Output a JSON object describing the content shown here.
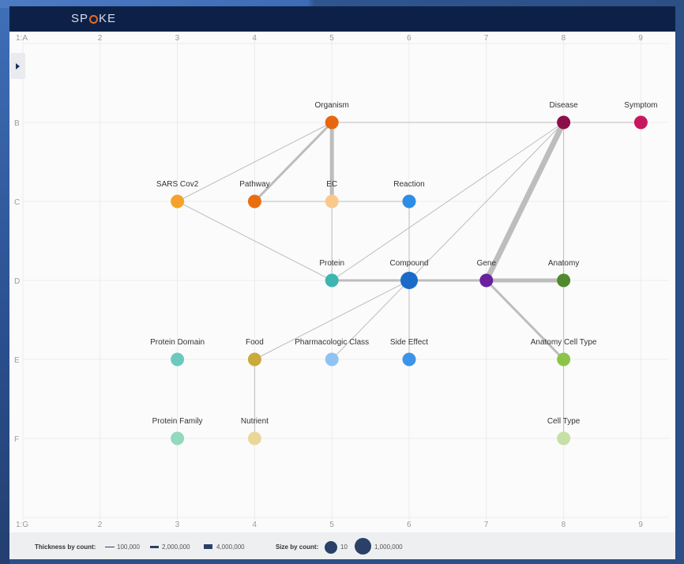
{
  "app": {
    "logo_text": "SPOKE"
  },
  "grid": {
    "columns": [
      "1:A",
      "2",
      "3",
      "4",
      "5",
      "6",
      "7",
      "8",
      "9"
    ],
    "bottom_columns": [
      "1:G",
      "2",
      "3",
      "4",
      "5",
      "6",
      "7",
      "8",
      "9"
    ],
    "rows": [
      "B",
      "C",
      "D",
      "E",
      "F"
    ]
  },
  "nodes": [
    {
      "id": "organism",
      "label": "Organism",
      "col": 5,
      "row": "B",
      "color": "#e8660d",
      "size": "m"
    },
    {
      "id": "disease",
      "label": "Disease",
      "col": 8,
      "row": "B",
      "color": "#8c0f4a",
      "size": "m"
    },
    {
      "id": "symptom",
      "label": "Symptom",
      "col": 9,
      "row": "B",
      "color": "#c9175f",
      "size": "m"
    },
    {
      "id": "sarscov2",
      "label": "SARS Cov2",
      "col": 3,
      "row": "C",
      "color": "#f6a22a",
      "size": "m"
    },
    {
      "id": "pathway",
      "label": "Pathway",
      "col": 4,
      "row": "C",
      "color": "#ea6e10",
      "size": "m"
    },
    {
      "id": "ec",
      "label": "EC",
      "col": 5,
      "row": "C",
      "color": "#f9c98c",
      "size": "m"
    },
    {
      "id": "reaction",
      "label": "Reaction",
      "col": 6,
      "row": "C",
      "color": "#2c8ee5",
      "size": "m"
    },
    {
      "id": "protein",
      "label": "Protein",
      "col": 5,
      "row": "D",
      "color": "#3db5b0",
      "size": "m"
    },
    {
      "id": "compound",
      "label": "Compound",
      "col": 6,
      "row": "D",
      "color": "#1b6ac7",
      "size": "l"
    },
    {
      "id": "gene",
      "label": "Gene",
      "col": 7,
      "row": "D",
      "color": "#6a1f9e",
      "size": "m"
    },
    {
      "id": "anatomy",
      "label": "Anatomy",
      "col": 8,
      "row": "D",
      "color": "#4f8a2c",
      "size": "m"
    },
    {
      "id": "proteindomain",
      "label": "Protein Domain",
      "col": 3,
      "row": "E",
      "color": "#6cc9bd",
      "size": "m"
    },
    {
      "id": "food",
      "label": "Food",
      "col": 4,
      "row": "E",
      "color": "#c9aa3a",
      "size": "m"
    },
    {
      "id": "pharmclass",
      "label": "Pharmacologic Class",
      "col": 5,
      "row": "E",
      "color": "#8fc3f3",
      "size": "m"
    },
    {
      "id": "sideeffect",
      "label": "Side Effect",
      "col": 6,
      "row": "E",
      "color": "#3c94e8",
      "size": "m"
    },
    {
      "id": "anatomycelltype",
      "label": "Anatomy Cell Type",
      "col": 8,
      "row": "E",
      "color": "#8cc44a",
      "size": "m"
    },
    {
      "id": "proteinfamily",
      "label": "Protein Family",
      "col": 3,
      "row": "F",
      "color": "#93d9bd",
      "size": "m"
    },
    {
      "id": "nutrient",
      "label": "Nutrient",
      "col": 4,
      "row": "F",
      "color": "#e9d79a",
      "size": "m"
    },
    {
      "id": "celltype",
      "label": "Cell Type",
      "col": 8,
      "row": "F",
      "color": "#c7e0a5",
      "size": "m"
    }
  ],
  "edges": [
    {
      "from": "organism",
      "to": "disease",
      "weight": "thin"
    },
    {
      "from": "disease",
      "to": "symptom",
      "weight": "thin"
    },
    {
      "from": "organism",
      "to": "sarscov2",
      "weight": "thin"
    },
    {
      "from": "organism",
      "to": "pathway",
      "weight": "medium"
    },
    {
      "from": "organism",
      "to": "ec",
      "weight": "thick"
    },
    {
      "from": "sarscov2",
      "to": "protein",
      "weight": "thin"
    },
    {
      "from": "pathway",
      "to": "ec",
      "weight": "thin"
    },
    {
      "from": "ec",
      "to": "reaction",
      "weight": "thin"
    },
    {
      "from": "ec",
      "to": "protein",
      "weight": "thin"
    },
    {
      "from": "reaction",
      "to": "compound",
      "weight": "thin"
    },
    {
      "from": "disease",
      "to": "protein",
      "weight": "thin"
    },
    {
      "from": "disease",
      "to": "compound",
      "weight": "thin"
    },
    {
      "from": "disease",
      "to": "gene",
      "weight": "heavy"
    },
    {
      "from": "disease",
      "to": "anatomy",
      "weight": "thin"
    },
    {
      "from": "protein",
      "to": "compound",
      "weight": "medium"
    },
    {
      "from": "compound",
      "to": "gene",
      "weight": "medium"
    },
    {
      "from": "gene",
      "to": "anatomy",
      "weight": "thick"
    },
    {
      "from": "gene",
      "to": "anatomycelltype",
      "weight": "medium"
    },
    {
      "from": "compound",
      "to": "food",
      "weight": "thin"
    },
    {
      "from": "compound",
      "to": "pharmclass",
      "weight": "thin"
    },
    {
      "from": "compound",
      "to": "sideeffect",
      "weight": "thin"
    },
    {
      "from": "anatomy",
      "to": "anatomycelltype",
      "weight": "thin"
    },
    {
      "from": "anatomycelltype",
      "to": "celltype",
      "weight": "thin"
    },
    {
      "from": "food",
      "to": "nutrient",
      "weight": "thin"
    }
  ],
  "legend": {
    "thickness_title": "Thickness by count:",
    "thickness_items": [
      "100,000",
      "2,000,000",
      "4,000,000"
    ],
    "size_title": "Size by count:",
    "size_items": [
      "10",
      "1,000,000"
    ]
  },
  "colors": {
    "header": "#0d2148",
    "edge": "#bdbdbd",
    "legend_marker": "#2b4068"
  }
}
